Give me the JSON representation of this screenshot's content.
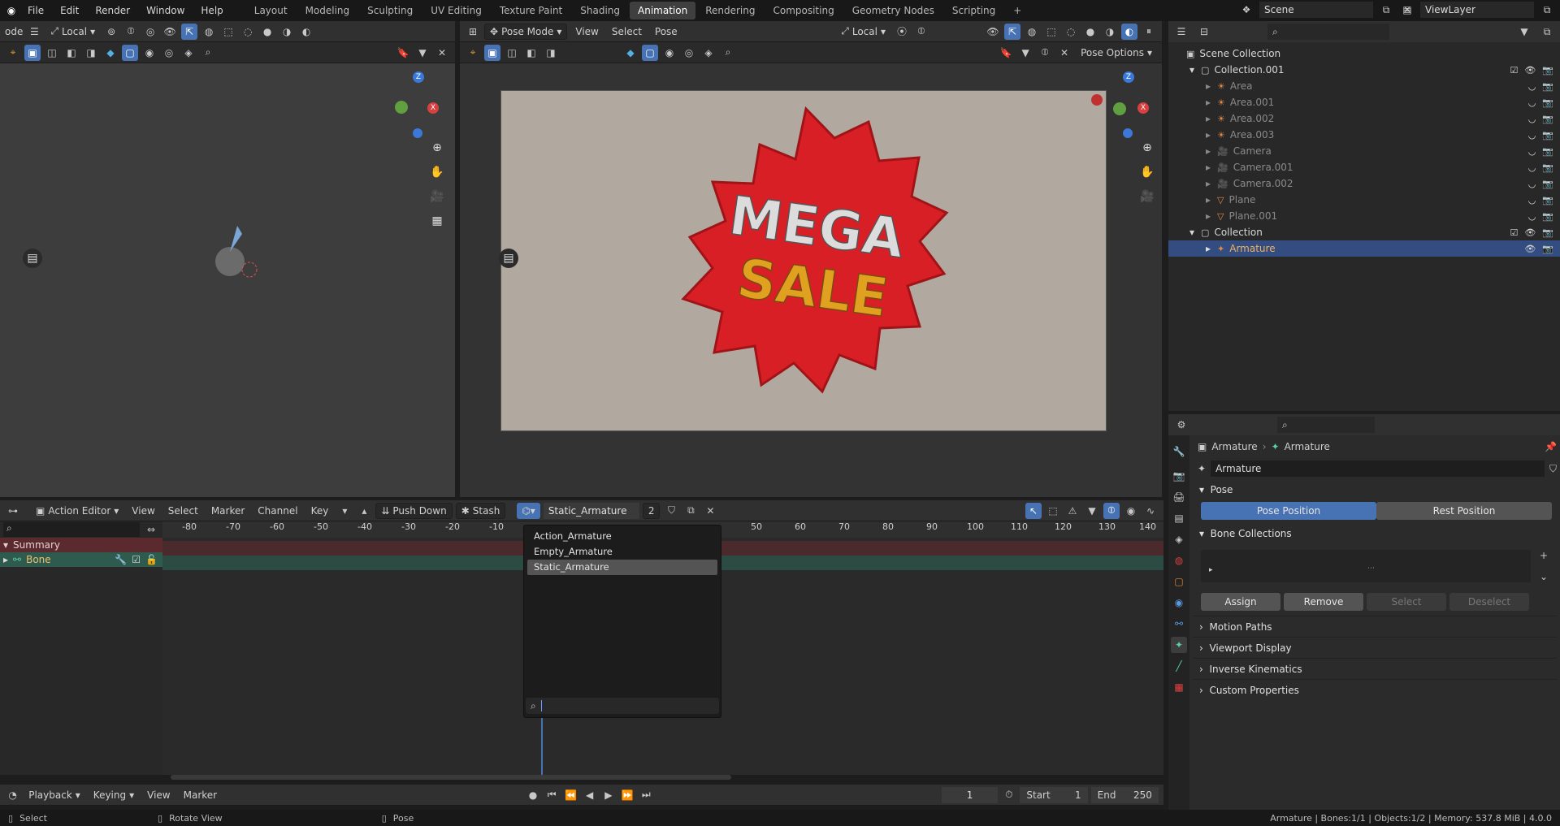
{
  "menus": {
    "file": "File",
    "edit": "Edit",
    "render": "Render",
    "window": "Window",
    "help": "Help"
  },
  "workspaces": [
    "Layout",
    "Modeling",
    "Sculpting",
    "UV Editing",
    "Texture Paint",
    "Shading",
    "Animation",
    "Rendering",
    "Compositing",
    "Geometry Nodes",
    "Scripting"
  ],
  "active_workspace": "Animation",
  "scene": {
    "name": "Scene",
    "view_layer": "ViewLayer"
  },
  "left_viewport": {
    "mode": "ode",
    "transform": "Local"
  },
  "camera_viewport": {
    "mode": "Pose Mode",
    "menus": [
      "View",
      "Select",
      "Pose"
    ],
    "transform": "Local",
    "pose_options": "Pose Options",
    "render_text_1": "MEGA",
    "render_text_2": "SALE"
  },
  "outliner": {
    "root": "Scene Collection",
    "collections": [
      {
        "name": "Collection.001",
        "items": [
          "Area",
          "Area.001",
          "Area.002",
          "Area.003",
          "Camera",
          "Camera.001",
          "Camera.002",
          "Plane",
          "Plane.001"
        ]
      },
      {
        "name": "Collection",
        "items": [
          "Armature"
        ]
      }
    ]
  },
  "properties": {
    "breadcrumb_1": "Armature",
    "breadcrumb_2": "Armature",
    "data_name": "Armature",
    "pose_section": "Pose",
    "pose_position": "Pose Position",
    "rest_position": "Rest Position",
    "bone_collections": "Bone Collections",
    "assign": "Assign",
    "remove": "Remove",
    "select": "Select",
    "deselect": "Deselect",
    "motion_paths": "Motion Paths",
    "viewport_display": "Viewport Display",
    "inverse_kinematics": "Inverse Kinematics",
    "custom_properties": "Custom Properties"
  },
  "action_editor": {
    "editor": "Action Editor",
    "menus": [
      "View",
      "Select",
      "Marker",
      "Channel",
      "Key"
    ],
    "push_down": "Push Down",
    "stash": "Stash",
    "action": "Static_Armature",
    "users": "2",
    "channels": [
      "Summary",
      "Bone"
    ],
    "ruler": [
      "-80",
      "-70",
      "-60",
      "-50",
      "-40",
      "-30",
      "-20",
      "-10",
      "50",
      "60",
      "70",
      "80",
      "90",
      "100",
      "110",
      "120",
      "130",
      "140"
    ],
    "dropdown": [
      "Action_Armature",
      "Empty_Armature",
      "Static_Armature"
    ],
    "dropdown_selected": "Static_Armature"
  },
  "timeline": {
    "menus": [
      "Playback",
      "Keying",
      "View",
      "Marker"
    ],
    "current_frame": "1",
    "start_label": "Start",
    "start": "1",
    "end_label": "End",
    "end": "250"
  },
  "statusbar": {
    "select": "Select",
    "rotate": "Rotate View",
    "pose": "Pose",
    "info": "Armature | Bones:1/1 | Objects:1/2 | Memory: 537.8 MiB | 4.0.0"
  }
}
